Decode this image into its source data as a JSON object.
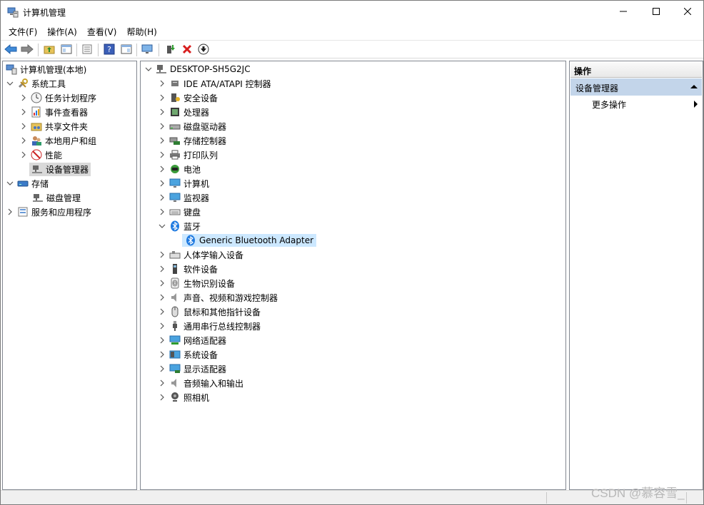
{
  "window": {
    "title": "计算机管理"
  },
  "menu": [
    "文件(F)",
    "操作(A)",
    "查看(V)",
    "帮助(H)"
  ],
  "left_tree": [
    {
      "label": "计算机管理(本地)",
      "icon": "computer-management-icon"
    },
    {
      "label": "系统工具",
      "icon": "tools-icon"
    },
    {
      "label": "任务计划程序",
      "icon": "clock-icon"
    },
    {
      "label": "事件查看器",
      "icon": "event-viewer-icon"
    },
    {
      "label": "共享文件夹",
      "icon": "shared-folder-icon"
    },
    {
      "label": "本地用户和组",
      "icon": "users-icon"
    },
    {
      "label": "性能",
      "icon": "performance-icon"
    },
    {
      "label": "设备管理器",
      "icon": "device-manager-icon"
    },
    {
      "label": "存储",
      "icon": "storage-icon"
    },
    {
      "label": "磁盘管理",
      "icon": "disk-management-icon"
    },
    {
      "label": "服务和应用程序",
      "icon": "services-icon"
    }
  ],
  "device_tree": {
    "root": "DESKTOP-SH5G2JC",
    "categories": [
      "IDE ATA/ATAPI 控制器",
      "安全设备",
      "处理器",
      "磁盘驱动器",
      "存储控制器",
      "打印队列",
      "电池",
      "计算机",
      "监视器",
      "键盘",
      "蓝牙",
      "Generic Bluetooth Adapter",
      "人体学输入设备",
      "软件设备",
      "生物识别设备",
      "声音、视频和游戏控制器",
      "鼠标和其他指针设备",
      "通用串行总线控制器",
      "网络适配器",
      "系统设备",
      "显示适配器",
      "音频输入和输出",
      "照相机"
    ]
  },
  "actions": {
    "header": "操作",
    "section": "设备管理器",
    "more": "更多操作"
  },
  "watermark": "CSDN @慕容雪_",
  "colors": {
    "selection_blue": "#cce8ff",
    "section_blue": "#c3d5ea",
    "close_red": "#e81123"
  }
}
